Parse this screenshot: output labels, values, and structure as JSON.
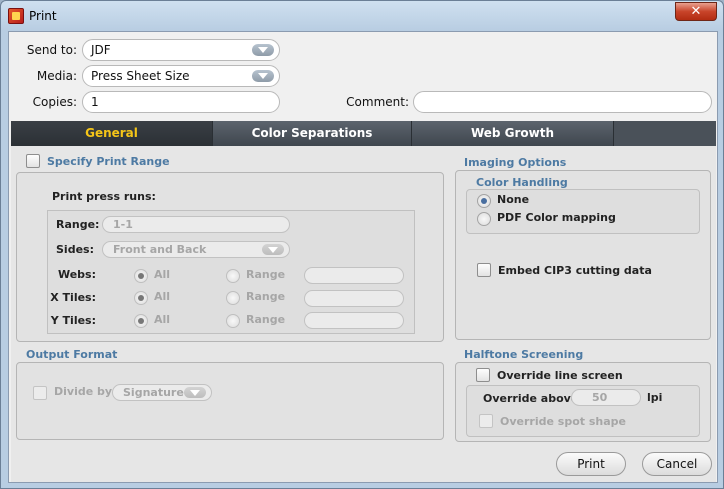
{
  "window": {
    "title": "Print",
    "close_label": "✕"
  },
  "form": {
    "send_to": {
      "label": "Send to:",
      "value": "JDF"
    },
    "media": {
      "label": "Media:",
      "value": "Press Sheet Size"
    },
    "copies": {
      "label": "Copies:",
      "value": "1"
    },
    "comment": {
      "label": "Comment:",
      "value": ""
    }
  },
  "tabs": [
    {
      "label": "General",
      "active": true
    },
    {
      "label": "Color Separations",
      "active": false
    },
    {
      "label": "Web Growth",
      "active": false
    }
  ],
  "print_range": {
    "title": "Specify Print Range",
    "press_runs_label": "Print press runs:",
    "range_label": "Range:",
    "range_value": "1-1",
    "sides_label": "Sides:",
    "sides_value": "Front and Back",
    "webs_label": "Webs:",
    "xtiles_label": "X Tiles:",
    "ytiles_label": "Y Tiles:",
    "all_label": "All",
    "range_option_label": "Range"
  },
  "output_format": {
    "title": "Output Format",
    "divide_by_label": "Divide by",
    "divide_by_value": "Signature"
  },
  "imaging": {
    "title": "Imaging Options",
    "color_handling_title": "Color Handling",
    "none_label": "None",
    "pdf_color_label": "PDF Color mapping",
    "embed_cip3_label": "Embed CIP3 cutting data"
  },
  "halftone": {
    "title": "Halftone Screening",
    "override_line_label": "Override line screen",
    "override_above_label": "Override above:",
    "override_above_value": "50",
    "unit": "lpi",
    "override_spot_label": "Override spot shape"
  },
  "buttons": {
    "print": "Print",
    "cancel": "Cancel"
  },
  "colors": {
    "active_tab_text": "#f5c518",
    "section_title": "#4d7aa3"
  }
}
